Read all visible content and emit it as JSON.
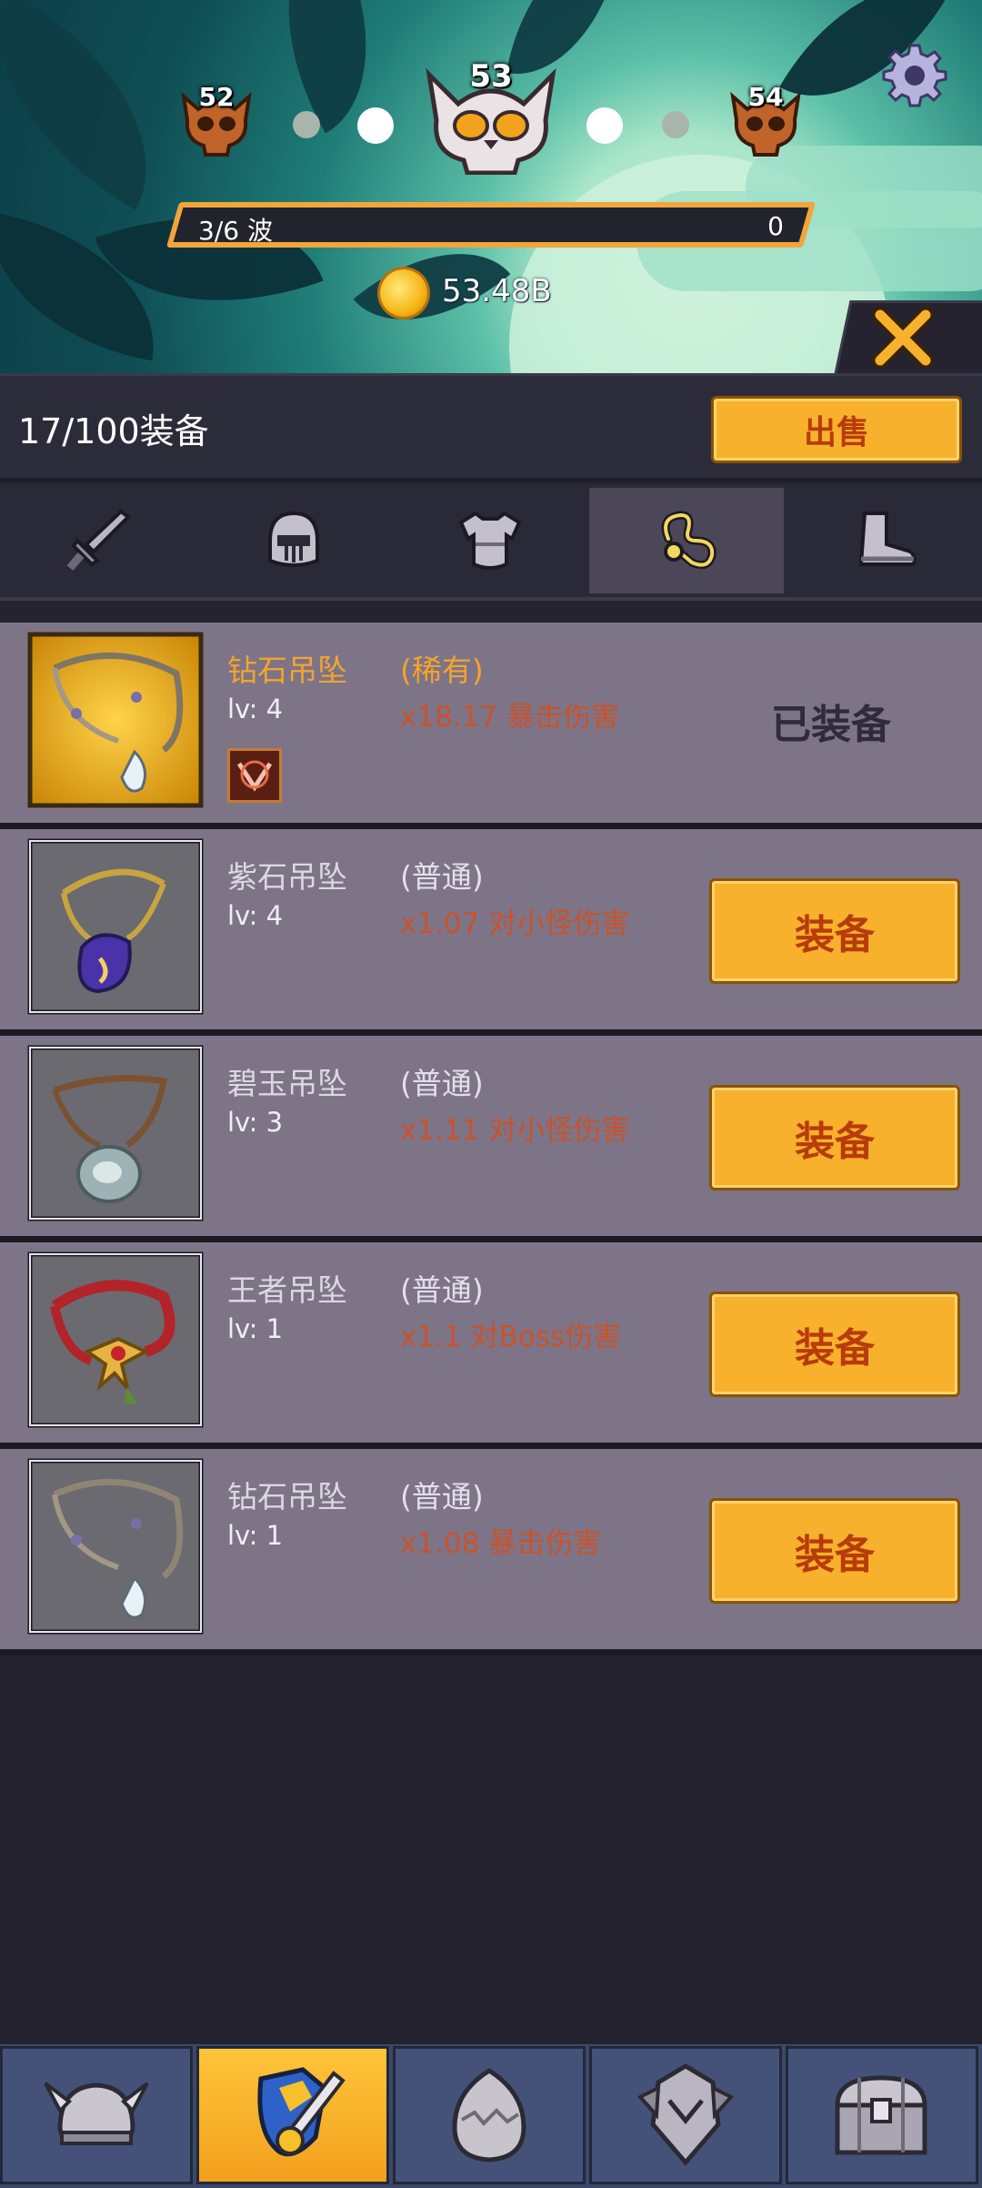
{
  "stage": {
    "prev_level": "52",
    "current_level": "53",
    "next_level": "54"
  },
  "wave": {
    "label": "3/6 波",
    "value": "0"
  },
  "currency": {
    "gold": "53.48B"
  },
  "inventory": {
    "count_label": "17/100装备",
    "sell_label": "出售"
  },
  "tabs": [
    {
      "icon": "sword-icon",
      "active": false
    },
    {
      "icon": "helmet-icon",
      "active": false
    },
    {
      "icon": "armor-icon",
      "active": false
    },
    {
      "icon": "necklace-icon",
      "active": true
    },
    {
      "icon": "boots-icon",
      "active": false
    }
  ],
  "items": [
    {
      "name": "钻石吊坠",
      "rarity": "(稀有)",
      "level": "lv: 4",
      "stat": "x18.17 暴击伤害",
      "status": "已装备",
      "rare": true
    },
    {
      "name": "紫石吊坠",
      "rarity": "(普通)",
      "level": "lv: 4",
      "stat": "x1.07 对小怪伤害",
      "action": "装备"
    },
    {
      "name": "碧玉吊坠",
      "rarity": "(普通)",
      "level": "lv: 3",
      "stat": "x1.11 对小怪伤害",
      "action": "装备"
    },
    {
      "name": "王者吊坠",
      "rarity": "(普通)",
      "level": "lv: 1",
      "stat": "x1.1 对Boss伤害",
      "action": "装备"
    },
    {
      "name": "钻石吊坠",
      "rarity": "(普通)",
      "level": "lv: 1",
      "stat": "x1.08 暴击伤害",
      "action": "装备"
    }
  ],
  "nav": [
    {
      "icon": "viking-helmet-icon",
      "active": false
    },
    {
      "icon": "shield-sword-icon",
      "active": true
    },
    {
      "icon": "egg-icon",
      "active": false
    },
    {
      "icon": "knight-armor-icon",
      "active": false
    },
    {
      "icon": "treasure-chest-icon",
      "active": false
    }
  ],
  "colors": {
    "accent": "#f7b12d",
    "rare": "#f4a42a",
    "stat": "#c9532a",
    "panel": "#7d7488"
  }
}
